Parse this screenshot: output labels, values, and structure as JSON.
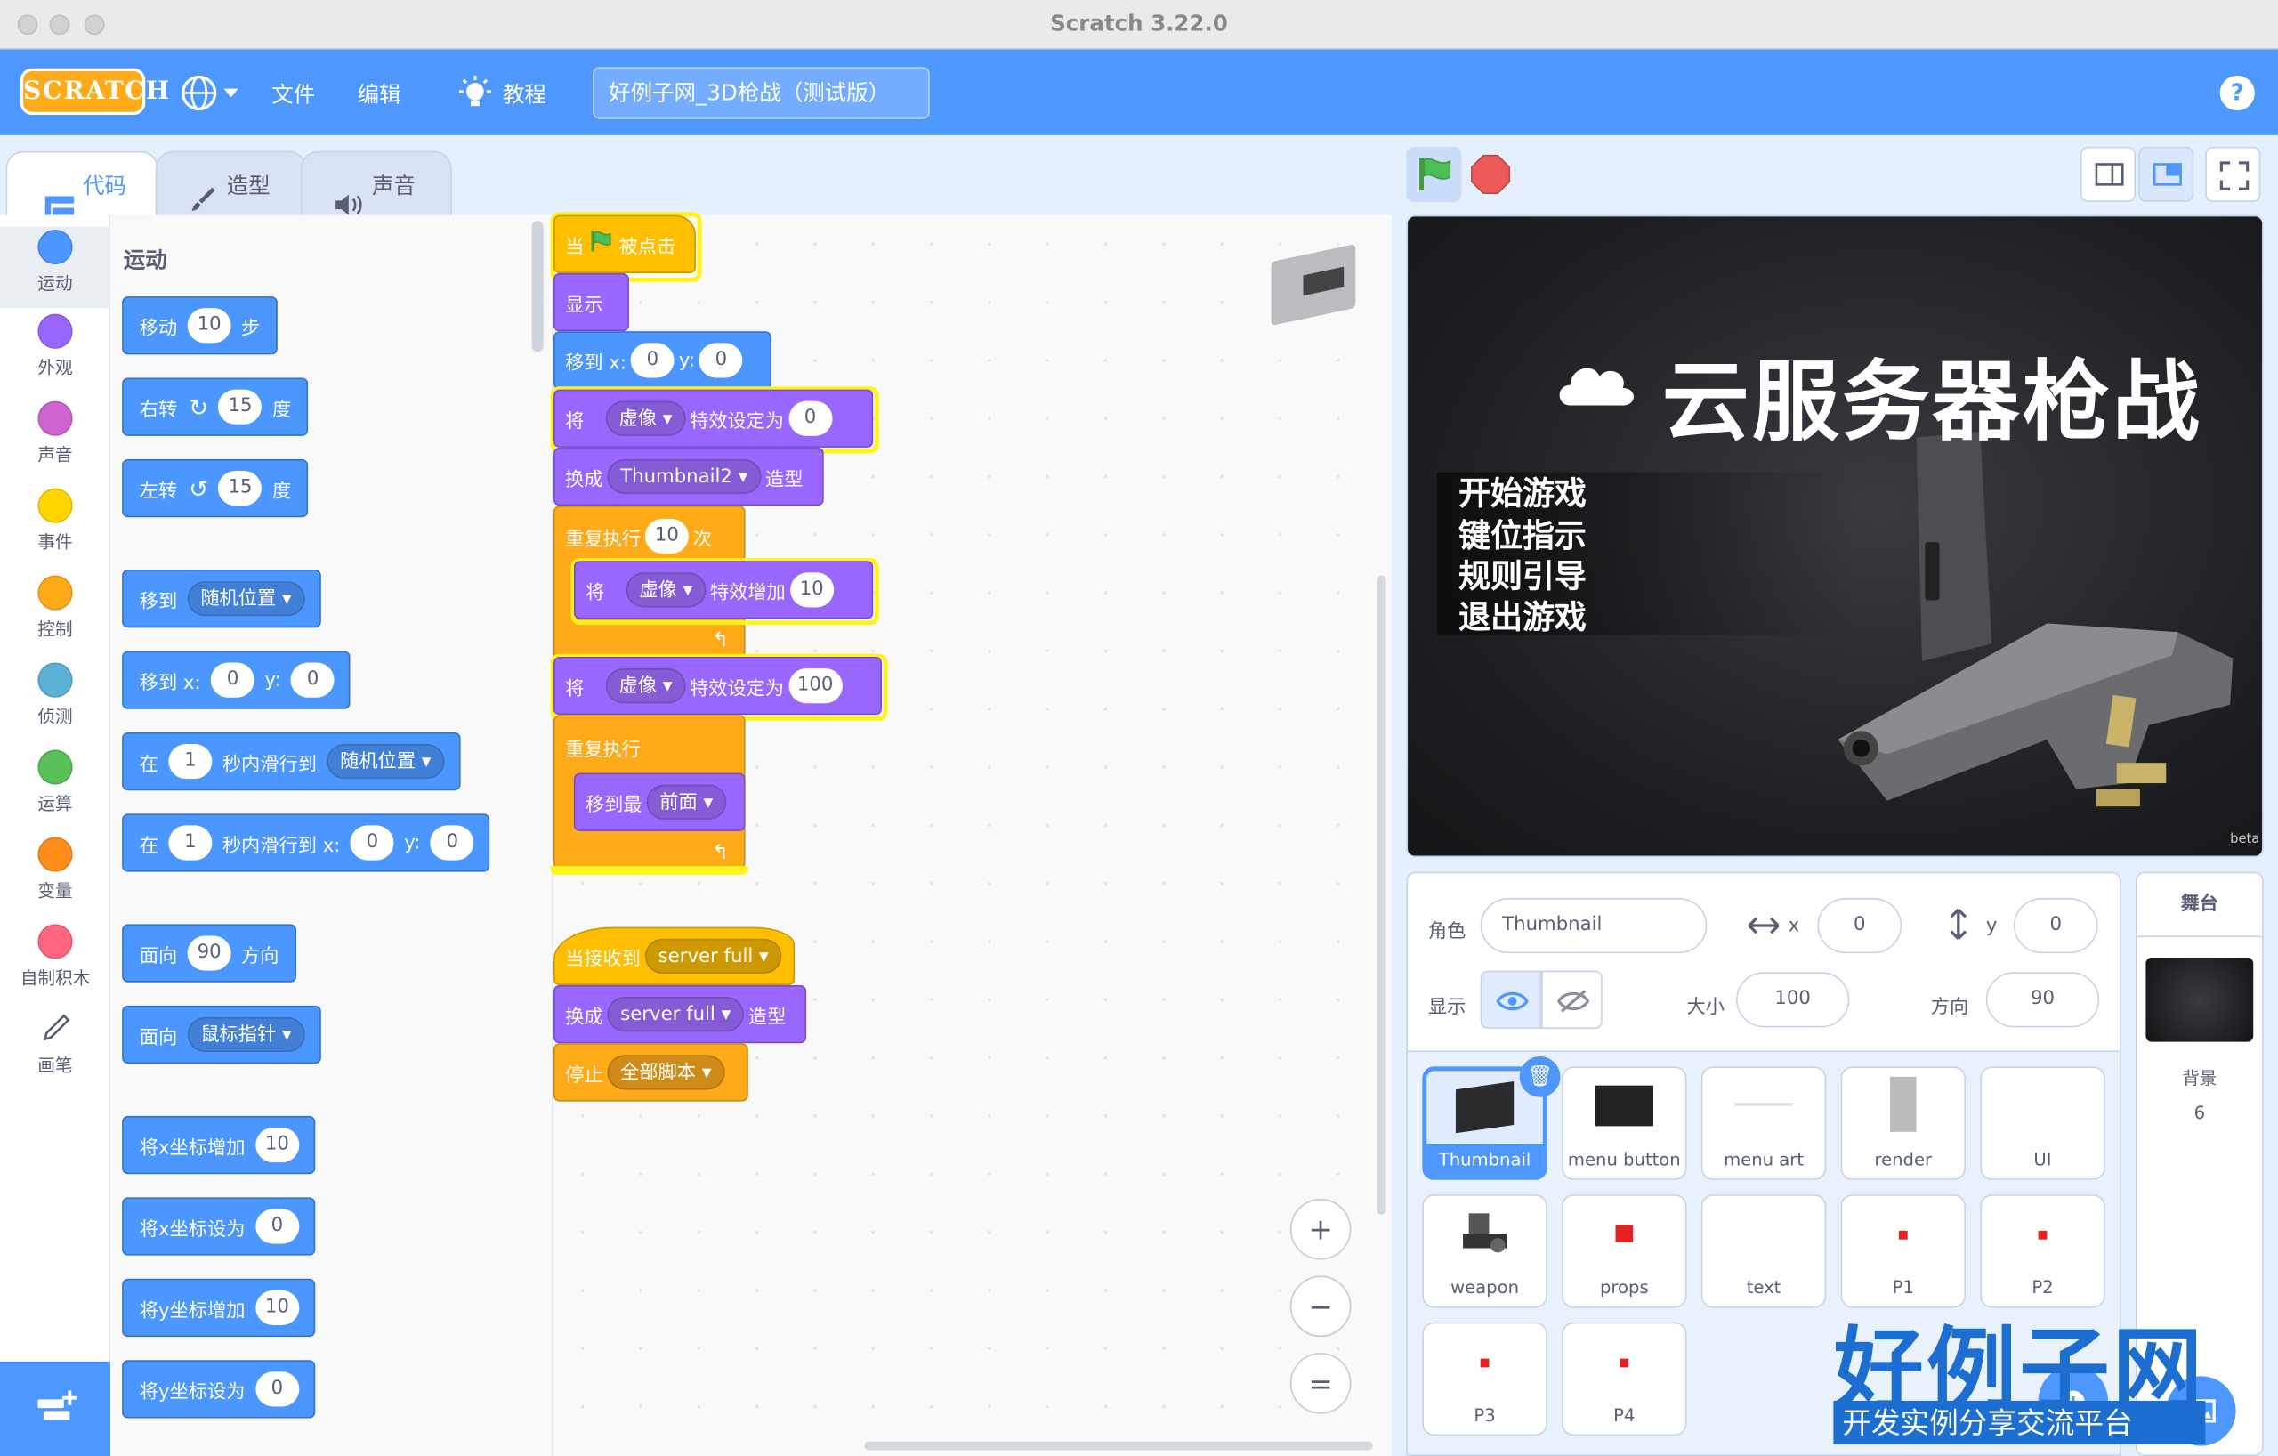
{
  "window": {
    "title": "Scratch 3.22.0"
  },
  "menubar": {
    "logo": "SCRATCH",
    "file": "文件",
    "edit": "编辑",
    "tutorials": "教程",
    "project_title": "好例子网_3D枪战（测试版）",
    "help": "?"
  },
  "tabs": {
    "code": "代码",
    "costumes": "造型",
    "sounds": "声音"
  },
  "categories": [
    {
      "label": "运动",
      "color": "#4c97ff"
    },
    {
      "label": "外观",
      "color": "#9966ff"
    },
    {
      "label": "声音",
      "color": "#cf63cf"
    },
    {
      "label": "事件",
      "color": "#ffd500"
    },
    {
      "label": "控制",
      "color": "#ffab19"
    },
    {
      "label": "侦测",
      "color": "#5cb1d6"
    },
    {
      "label": "运算",
      "color": "#59c059"
    },
    {
      "label": "变量",
      "color": "#ff8c1a"
    },
    {
      "label": "自制积木",
      "color": "#ff6680"
    },
    {
      "label": "画笔",
      "color": "#0fbd8c"
    }
  ],
  "palette": {
    "heading": "运动",
    "move": {
      "a": "移动",
      "v": "10",
      "b": "步"
    },
    "turn_right": {
      "a": "右转",
      "v": "15",
      "b": "度"
    },
    "turn_left": {
      "a": "左转",
      "v": "15",
      "b": "度"
    },
    "goto": {
      "a": "移到",
      "dd": "随机位置"
    },
    "goto_xy": {
      "a": "移到 x:",
      "x": "0",
      "yl": "y:",
      "y": "0"
    },
    "glide": {
      "a": "在",
      "v": "1",
      "b": "秒内滑行到",
      "dd": "随机位置"
    },
    "glide_xy": {
      "a": "在",
      "v": "1",
      "b": "秒内滑行到 x:",
      "x": "0",
      "yl": "y:",
      "y": "0"
    },
    "point_dir": {
      "a": "面向",
      "v": "90",
      "b": "方向"
    },
    "point_towards": {
      "a": "面向",
      "dd": "鼠标指针"
    },
    "change_x": {
      "a": "将x坐标增加",
      "v": "10"
    },
    "set_x": {
      "a": "将x坐标设为",
      "v": "0"
    },
    "change_y": {
      "a": "将y坐标增加",
      "v": "10"
    },
    "set_y": {
      "a": "将y坐标设为",
      "v": "0"
    }
  },
  "script1": {
    "hat": {
      "a": "当",
      "b": "被点击"
    },
    "show": "显示",
    "goto_xy": {
      "a": "移到 x:",
      "x": "0",
      "yl": "y:",
      "y": "0"
    },
    "set_effect": {
      "a": "将",
      "dd": "虚像",
      "b": "特效设定为",
      "v": "0"
    },
    "switch_costume": {
      "a": "换成",
      "dd": "Thumbnail2",
      "b": "造型"
    },
    "repeat": {
      "a": "重复执行",
      "v": "10",
      "b": "次"
    },
    "change_effect": {
      "a": "将",
      "dd": "虚像",
      "b": "特效增加",
      "v": "10"
    },
    "set_effect2": {
      "a": "将",
      "dd": "虚像",
      "b": "特效设定为",
      "v": "100"
    },
    "forever": "重复执行",
    "front": {
      "a": "移到最",
      "dd": "前面"
    }
  },
  "script2": {
    "hat": {
      "a": "当接收到",
      "dd": "server full"
    },
    "switch": {
      "a": "换成",
      "dd": "server full",
      "b": "造型"
    },
    "stop": {
      "a": "停止",
      "dd": "全部脚本"
    }
  },
  "stage": {
    "title": "云服务器枪战",
    "menu": [
      "开始游戏",
      "键位指示",
      "规则引导",
      "退出游戏"
    ],
    "beta": "beta"
  },
  "sprite_info": {
    "sprite_label": "角色",
    "sprite_name": "Thumbnail",
    "x_label": "x",
    "x": "0",
    "y_label": "y",
    "y": "0",
    "show_label": "显示",
    "size_label": "大小",
    "size": "100",
    "direction_label": "方向",
    "direction": "90"
  },
  "sprites": [
    "Thumbnail",
    "menu button",
    "menu art",
    "render",
    "UI",
    "weapon",
    "props",
    "text",
    "P1",
    "P2",
    "P3",
    "P4"
  ],
  "stage_panel": {
    "title": "舞台",
    "backdrops_label": "背景",
    "backdrops_count": "6"
  },
  "watermark": {
    "main": "好例子网",
    "sub": "开发实例分享交流平台"
  }
}
